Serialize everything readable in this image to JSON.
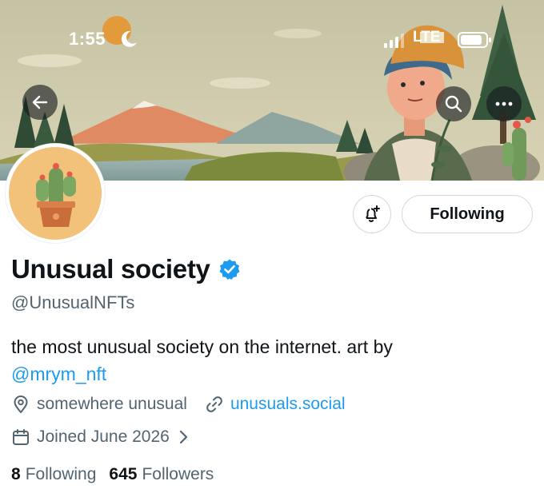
{
  "status_bar": {
    "time": "1:55",
    "network": "LTE"
  },
  "profile": {
    "display_name": "Unusual society",
    "handle": "@UnusualNFTs",
    "bio_text": "the most unusual society on the internet. art by",
    "bio_mention": "@mrym_nft",
    "location": "somewhere unusual",
    "website": "unusuals.social",
    "joined": "Joined June 2026",
    "following_count": "8",
    "following_label": "Following",
    "followers_count": "645",
    "followers_label": "Followers"
  },
  "actions": {
    "following_button": "Following"
  },
  "icons": {
    "back": "back-arrow-icon",
    "search": "search-icon",
    "more": "more-dots-icon",
    "notify": "bell-plus-icon",
    "verified": "verified-badge-icon",
    "location": "location-pin-icon",
    "link": "link-icon",
    "calendar": "calendar-icon",
    "chevron": "chevron-right-icon"
  },
  "colors": {
    "accent": "#1d9bf0",
    "secondary_text": "#536471",
    "primary_text": "#0f1419",
    "border": "#cfd9de"
  }
}
